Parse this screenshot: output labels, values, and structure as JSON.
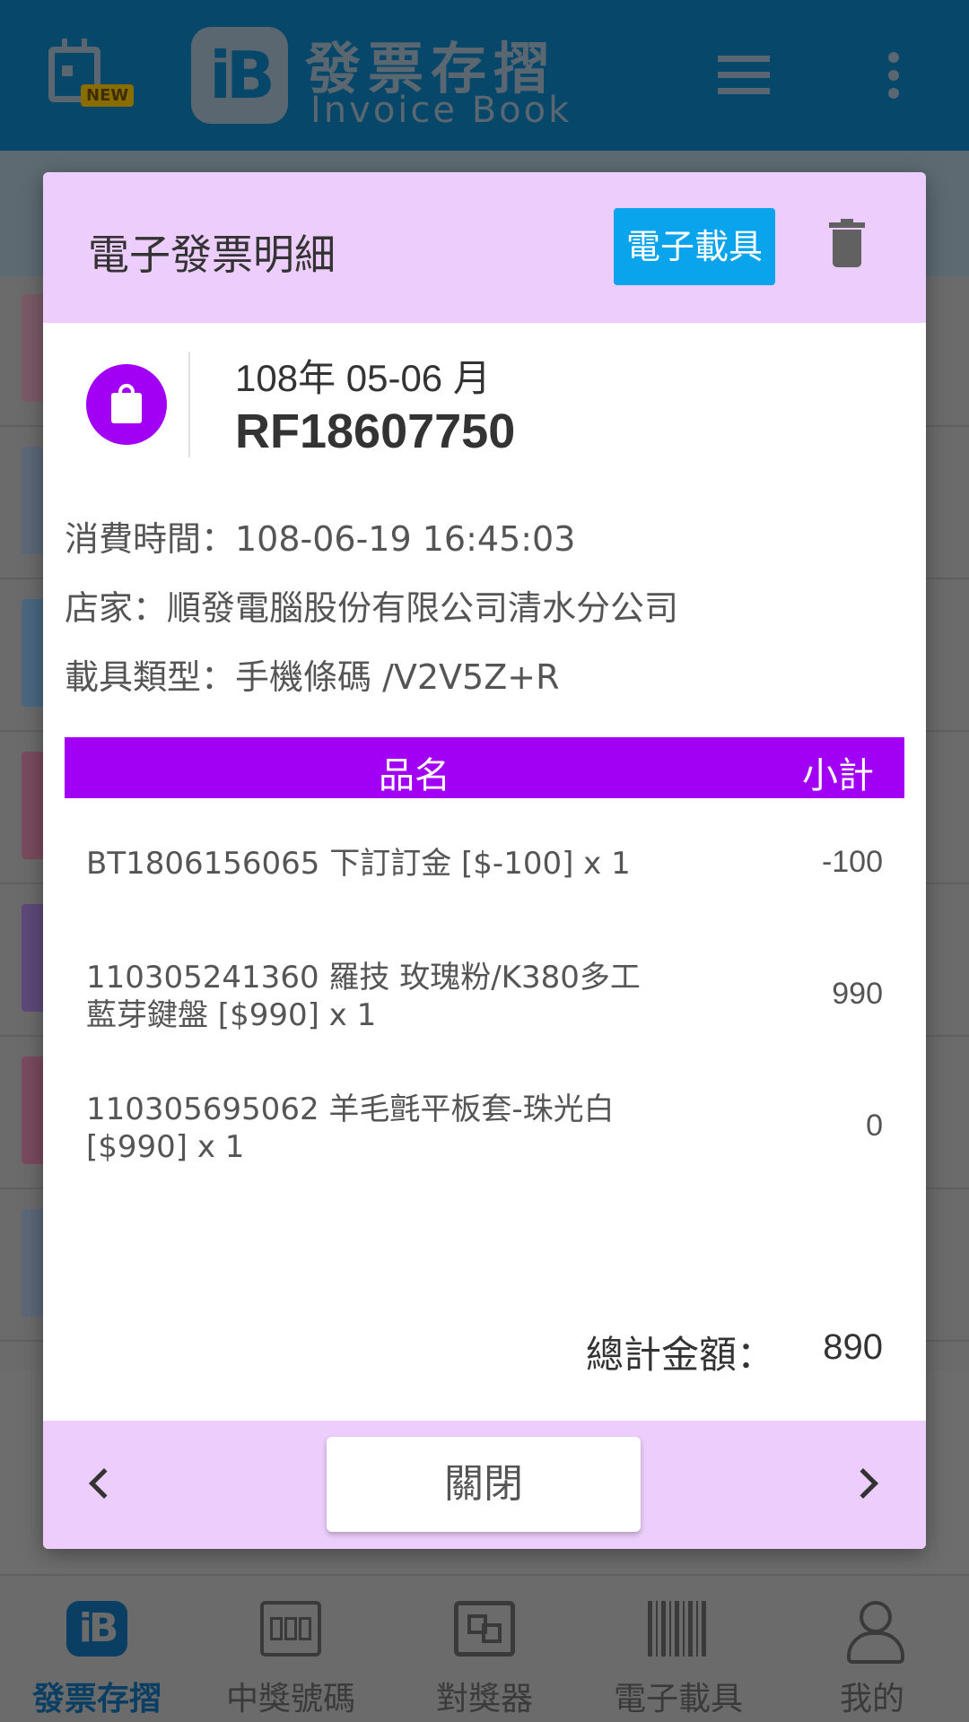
{
  "app": {
    "new_badge": "NEW",
    "logo_mark": "iB",
    "logo_title_zh": "發票存摺",
    "logo_title_en": "Invoice Book",
    "icons": [
      "calendar-icon",
      "tune-icon",
      "more-vert-icon"
    ]
  },
  "dialog": {
    "title": "電子發票明細",
    "carrier_button": "電子載具",
    "period": "108年 05-06 月",
    "invoice_number": "RF18607750",
    "consume_time": "消費時間：108-06-19 16:45:03",
    "store": "店家：順發電腦股份有限公司清水分公司",
    "carrier_type": "載具類型：手機條碼 /V2V5Z+R",
    "table": {
      "col_name": "品名",
      "col_subtotal": "小計",
      "items": [
        {
          "name": "BT1806156065 下訂訂金 [$-100] x 1",
          "amount": "-100"
        },
        {
          "name": "110305241360 羅技 玫瑰粉/K380多工藍芽鍵盤 [$990] x 1",
          "amount": "990"
        },
        {
          "name": "110305695062 羊毛氈平板套-珠光白 [$990] x 1",
          "amount": "0"
        }
      ]
    },
    "total_label": "總計金額：",
    "total_value": "890",
    "close_button": "關閉"
  },
  "bottom_nav": [
    {
      "label": "發票存摺",
      "icon": "invoice-book-icon",
      "active": true
    },
    {
      "label": "中獎號碼",
      "icon": "winning-numbers-icon",
      "active": false
    },
    {
      "label": "對獎器",
      "icon": "qr-scanner-icon",
      "active": false
    },
    {
      "label": "電子載具",
      "icon": "barcode-icon",
      "active": false
    },
    {
      "label": "我的",
      "icon": "person-icon",
      "active": false
    }
  ],
  "colors": {
    "appbar": "#06476a",
    "dialog_header": "#eccdfb",
    "accent_purple": "#a100f4",
    "carrier_blue": "#09a4ec"
  }
}
